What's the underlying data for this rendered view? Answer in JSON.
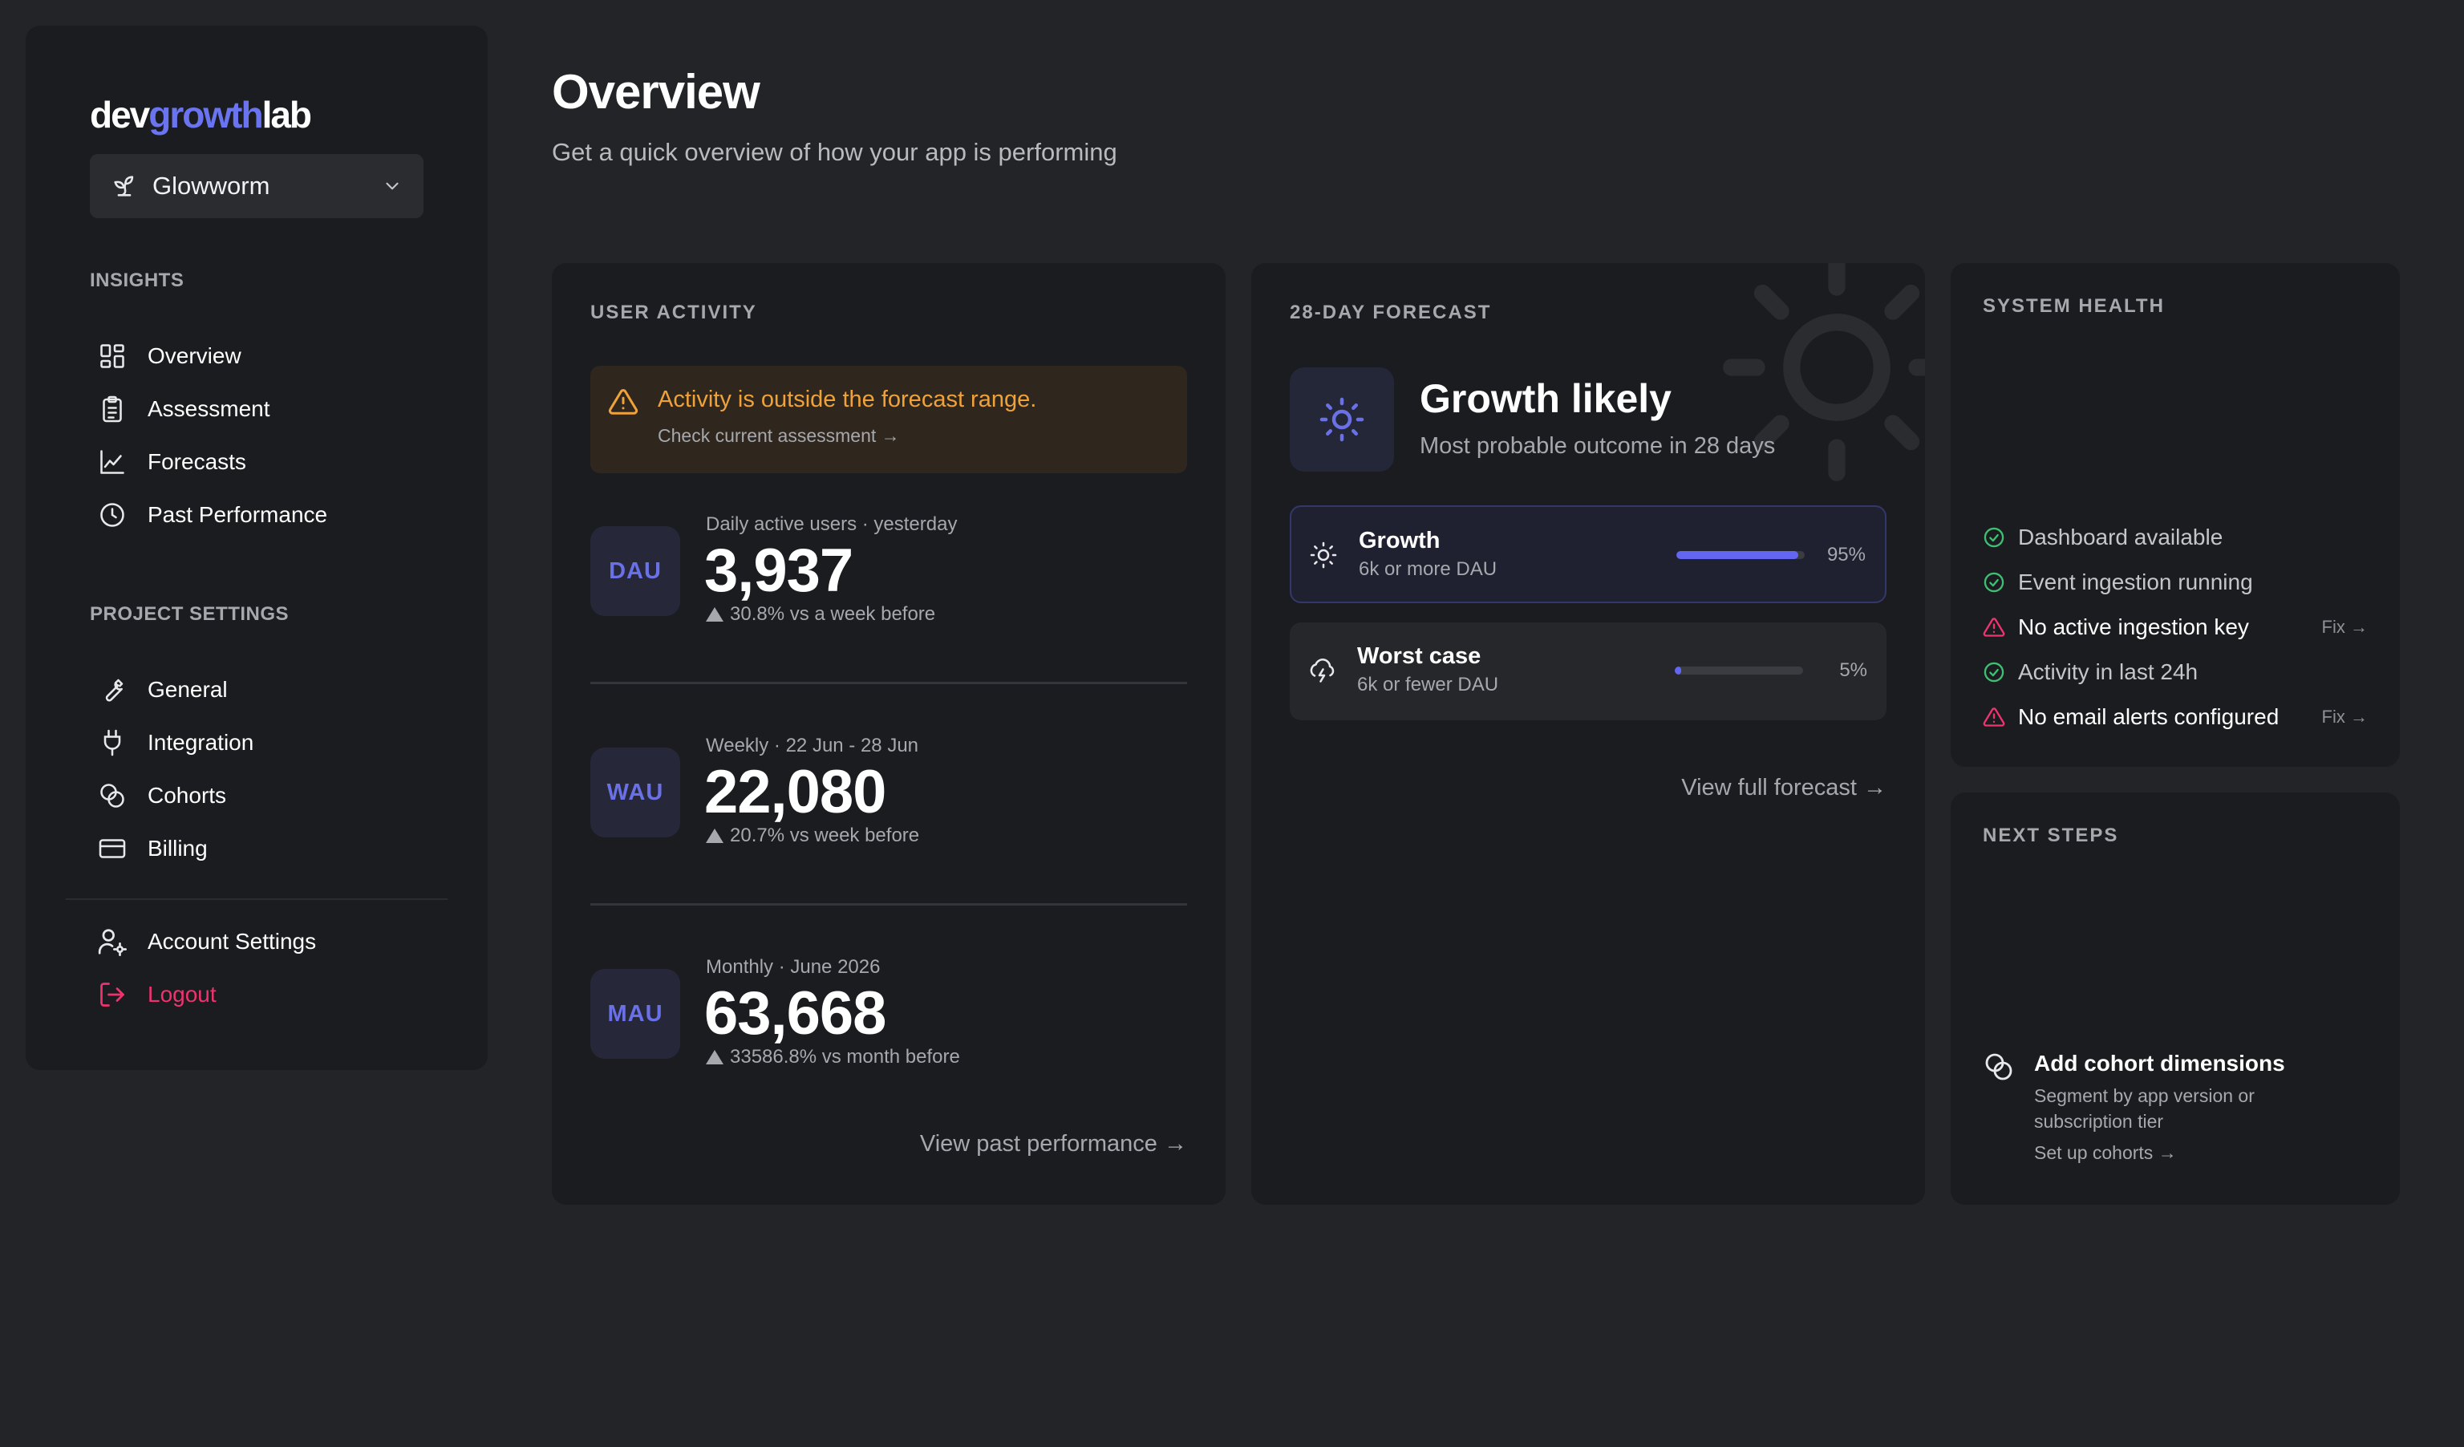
{
  "brand": {
    "part1": "dev",
    "part2": "growth",
    "part3": "lab"
  },
  "project": {
    "name": "Glowworm"
  },
  "sidebar": {
    "insights_label": "INSIGHTS",
    "insights": [
      {
        "label": "Overview",
        "icon": "dashboard-icon"
      },
      {
        "label": "Assessment",
        "icon": "clipboard-icon"
      },
      {
        "label": "Forecasts",
        "icon": "line-chart-icon"
      },
      {
        "label": "Past Performance",
        "icon": "clock-icon"
      }
    ],
    "settings_label": "PROJECT SETTINGS",
    "settings": [
      {
        "label": "General",
        "icon": "wrench-icon"
      },
      {
        "label": "Integration",
        "icon": "plug-icon"
      },
      {
        "label": "Cohorts",
        "icon": "cohorts-icon"
      },
      {
        "label": "Billing",
        "icon": "credit-card-icon"
      }
    ],
    "account_settings": "Account Settings",
    "logout": "Logout"
  },
  "header": {
    "title": "Overview",
    "subtitle": "Get a quick overview of how your app is performing"
  },
  "user_activity": {
    "label": "USER ACTIVITY",
    "alert": {
      "title": "Activity is outside the forecast range.",
      "link": "Check current assessment →"
    },
    "metrics": [
      {
        "badge": "DAU",
        "caption": "Daily active users · yesterday",
        "value": "3,937",
        "delta": "30.8% vs a week before"
      },
      {
        "badge": "WAU",
        "caption": "Weekly · 22 Jun - 28 Jun",
        "value": "22,080",
        "delta": "20.7% vs week before"
      },
      {
        "badge": "MAU",
        "caption": "Monthly · June 2026",
        "value": "63,668",
        "delta": "33586.8% vs month before"
      }
    ],
    "link": "View past performance →"
  },
  "forecast": {
    "label": "28-DAY FORECAST",
    "title": "Growth likely",
    "subtitle": "Most probable outcome in 28 days",
    "scenarios": [
      {
        "name": "Growth",
        "desc": "6k or more DAU",
        "percent": 95,
        "percent_label": "95%",
        "icon": "sun-icon"
      },
      {
        "name": "Worst case",
        "desc": "6k or fewer DAU",
        "percent": 5,
        "percent_label": "5%",
        "icon": "storm-cloud-icon"
      }
    ],
    "link": "View full forecast →"
  },
  "system_health": {
    "label": "SYSTEM HEALTH",
    "items": [
      {
        "text": "Dashboard available",
        "status": "ok"
      },
      {
        "text": "Event ingestion running",
        "status": "ok"
      },
      {
        "text": "No active ingestion key",
        "status": "bad",
        "fix": "Fix →"
      },
      {
        "text": "Activity in last 24h",
        "status": "ok"
      },
      {
        "text": "No email alerts configured",
        "status": "bad",
        "fix": "Fix →"
      }
    ]
  },
  "next_steps": {
    "label": "NEXT STEPS",
    "title": "Add cohort dimensions",
    "desc": "Segment by app version or subscription tier",
    "link": "Set up cohorts →"
  },
  "colors": {
    "accent": "#6366f1",
    "ok": "#3fbf73",
    "bad": "#f0336e",
    "warning": "#f0a23a"
  }
}
